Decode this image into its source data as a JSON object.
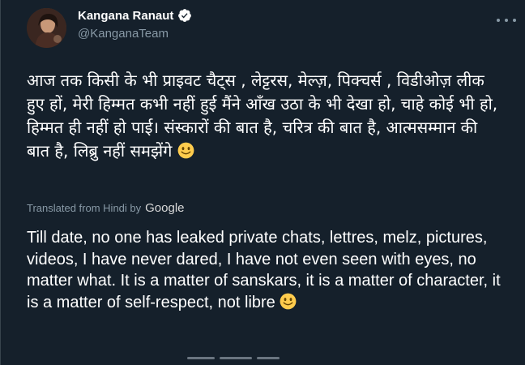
{
  "author": {
    "display_name": "Kangana Ranaut",
    "handle": "@KanganaTeam",
    "verified": true
  },
  "tweet": {
    "hindi_text": "आज तक किसी के भी प्राइवट चैट्स , लेट्टरस, मेल्ज़, पिक्चर्स , विडीओज़ लीक हुए हों, मेरी हिम्मत कभी नहीं हुई मैंने आँख उठा के भी देखा हो, चाहे कोई भी हो, हिम्मत ही नहीं हो पाई। संस्कारों की बात है, चरित्र की बात है, आत्मसम्मान की बात है, लिब्रु नहीं समझेंगे",
    "translated_label": "Translated from Hindi by",
    "translator": "Google",
    "translated_text": "Till date, no one has leaked private chats, lettres, melz, pictures, videos, I have never dared, I have not even seen with eyes, no matter what. It is a matter of sanskars, it is a matter of character, it is a matter of self-respect, not libre"
  },
  "colors": {
    "background": "#15202b",
    "text": "#ffffff",
    "secondary_text": "#8899a6",
    "verified_badge": "#ffffff"
  },
  "icons": {
    "verified": "verified-badge-icon",
    "more": "more-options-icon",
    "emoji": "slightly-smiling-face-icon"
  }
}
